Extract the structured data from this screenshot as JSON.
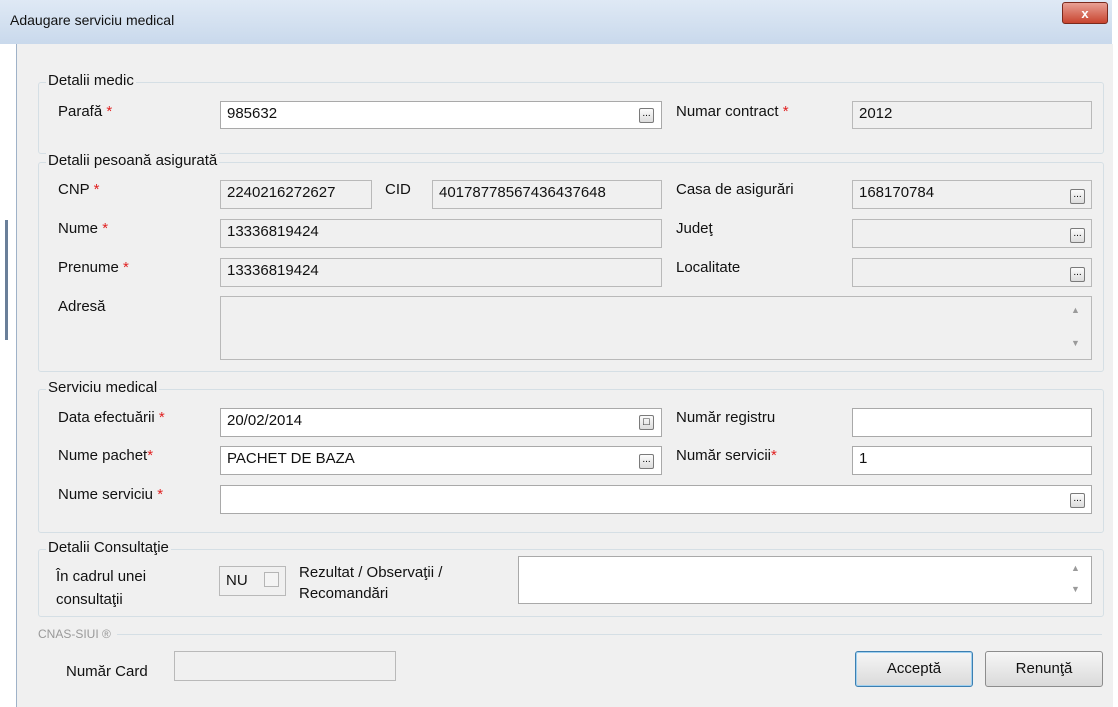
{
  "window": {
    "title": "Adaugare serviciu medical",
    "close_label": "x"
  },
  "groups": {
    "medic": "Detalii medic",
    "asigurat": "Detalii pesoană asigurată",
    "serviciu": "Serviciu medical",
    "consultatie": "Detalii Consultaţie"
  },
  "medic": {
    "parafa_label": "Parafă",
    "parafa_value": "985632",
    "contract_label": "Numar contract",
    "contract_value": "2012"
  },
  "asigurat": {
    "cnp_label": "CNP",
    "cnp_value": "2240216272627",
    "cid_label": "CID",
    "cid_value": "4017877856743643764­8",
    "casa_label": "Casa de asigurări",
    "casa_value": "168170784",
    "nume_label": "Nume",
    "nume_value": "13336819424",
    "judet_label": "Judeţ",
    "judet_value": "",
    "prenume_label": "Prenume",
    "prenume_value": "13336819424",
    "localitate_label": "Localitate",
    "localitate_value": "",
    "adresa_label": "Adresă",
    "adresa_value": ""
  },
  "serviciu": {
    "data_label": "Data efectuării",
    "data_value": "20/02/2014",
    "registru_label": "Număr registru",
    "registru_value": "",
    "pachet_label": "Nume pachet",
    "pachet_value": "PACHET DE BAZA",
    "nr_servicii_label": "Număr servicii",
    "nr_servicii_value": "1",
    "nume_serviciu_label": "Nume serviciu",
    "nume_serviciu_value": ""
  },
  "consultatie": {
    "in_cadrul_label_1": "În cadrul unei",
    "in_cadrul_label_2": "consultaţii",
    "nu_label": "NU",
    "rezultat_label_1": "Rezultat / Observaţii /",
    "rezultat_label_2": "Recomandări",
    "rezultat_value": ""
  },
  "footer": {
    "brand": "CNAS-SIUI ®",
    "card_label": "Număr Card",
    "card_value": "",
    "accept_label": "Acceptă",
    "cancel_label": "Renunţă"
  },
  "required_marker": "*",
  "browse_glyph": "...",
  "date_glyph": "□",
  "scroll_up": "▲",
  "scroll_down": "▼",
  "colors": {
    "required": "#e02020",
    "default_button_border": "#3c7fb1"
  }
}
